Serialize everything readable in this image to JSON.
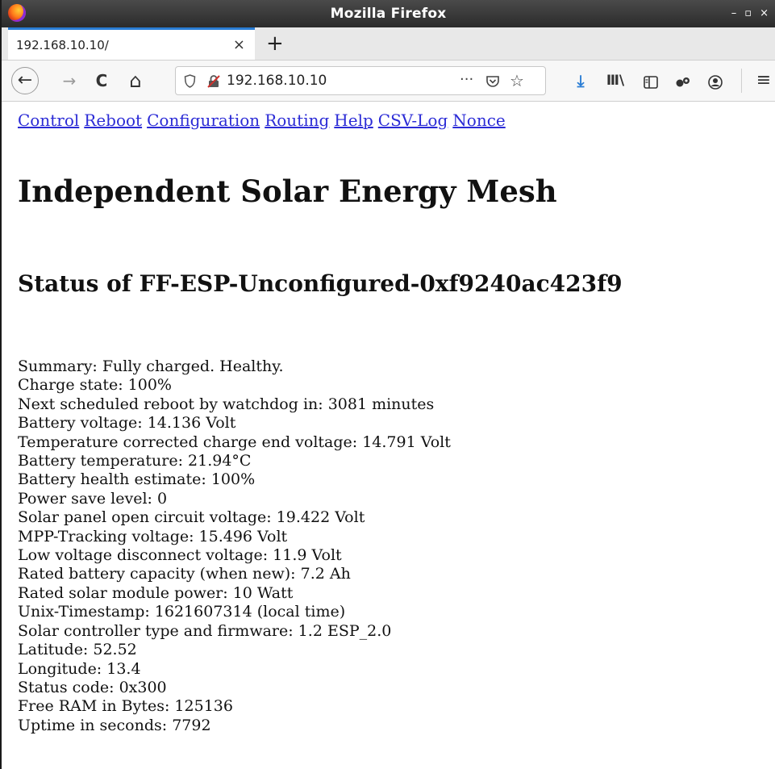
{
  "window": {
    "title": "Mozilla Firefox",
    "controls": [
      "–",
      "▫",
      "×"
    ]
  },
  "tabs": [
    {
      "label": "192.168.10.10/",
      "close": "×"
    }
  ],
  "new_tab_label": "+",
  "navbar": {
    "back": "←",
    "forward": "→",
    "reload": "C",
    "home": "⌂",
    "url": "192.168.10.10",
    "more": "···",
    "star": "☆",
    "download": "⤓",
    "library": "Ⅲ\\",
    "menu": "≡"
  },
  "page": {
    "nav_links": [
      "Control",
      "Reboot",
      "Configuration",
      "Routing",
      "Help",
      "CSV-Log",
      "Nonce"
    ],
    "title": "Independent Solar Energy Mesh",
    "status_title": "Status of FF-ESP-Unconfigured-0xf9240ac423f9",
    "status_lines": [
      "Summary: Fully charged. Healthy.",
      "Charge state: 100%",
      "Next scheduled reboot by watchdog in: 3081 minutes",
      "Battery voltage: 14.136 Volt",
      "Temperature corrected charge end voltage: 14.791 Volt",
      "Battery temperature: 21.94°C",
      "Battery health estimate: 100%",
      "Power save level: 0",
      "Solar panel open circuit voltage: 19.422 Volt",
      "MPP-Tracking voltage: 15.496 Volt",
      "Low voltage disconnect voltage: 11.9 Volt",
      "Rated battery capacity (when new): 7.2 Ah",
      "Rated solar module power: 10 Watt",
      "Unix-Timestamp: 1621607314 (local time)",
      "Solar controller type and firmware: 1.2 ESP_2.0",
      "Latitude: 52.52",
      "Longitude: 13.4",
      "Status code: 0x300",
      "Free RAM in Bytes: 125136",
      "Uptime in seconds: 7792"
    ]
  }
}
